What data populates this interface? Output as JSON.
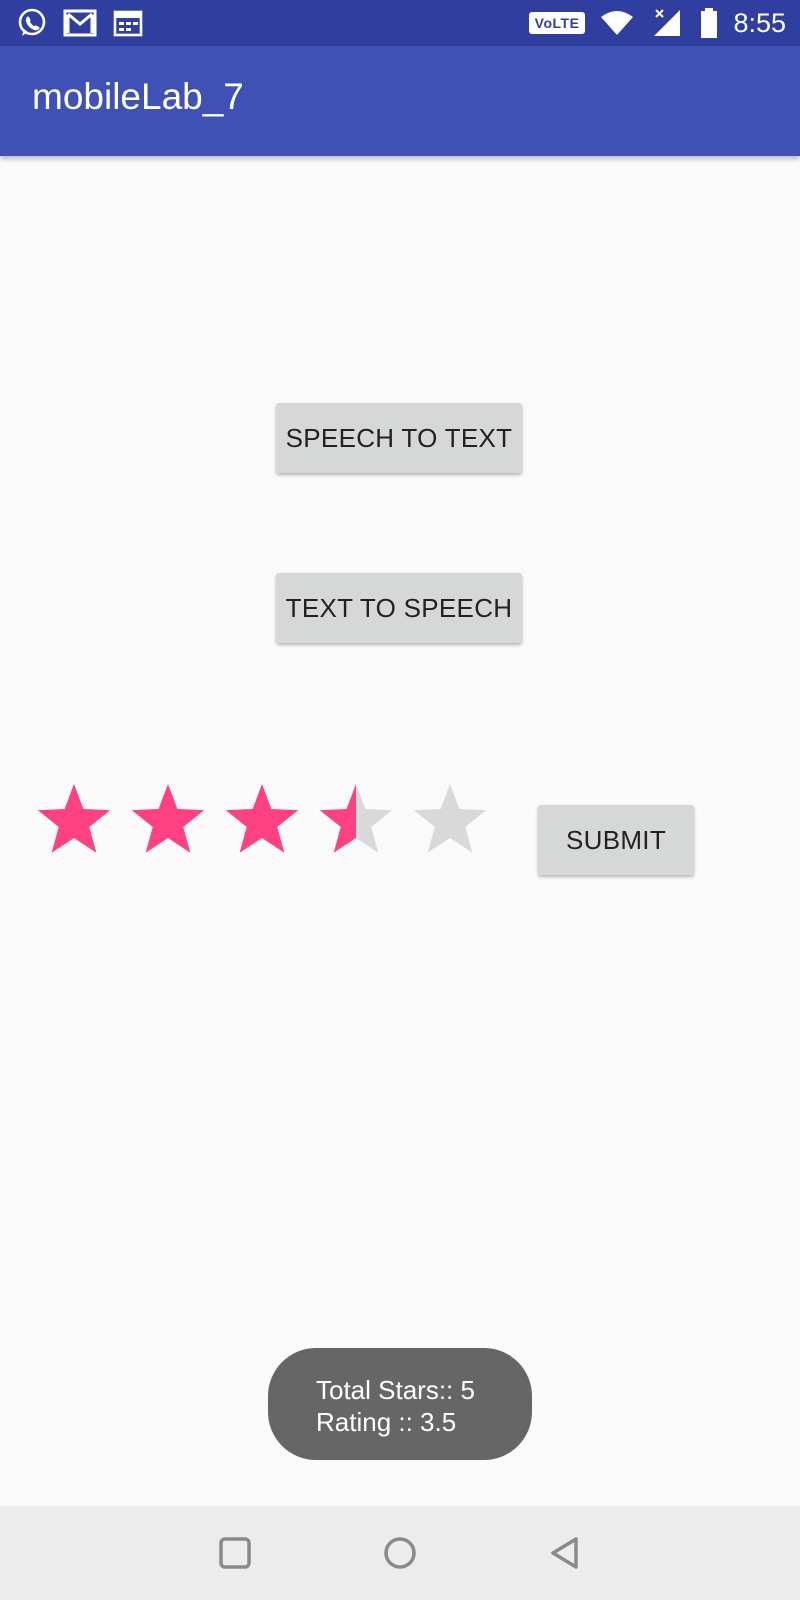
{
  "status_bar": {
    "time": "8:55",
    "network_badge": "VoLTE",
    "icons": [
      "whatsapp-icon",
      "gmail-icon",
      "calendar-icon",
      "wifi-icon",
      "signal-icon",
      "battery-icon"
    ]
  },
  "app_bar": {
    "title": "mobileLab_7"
  },
  "buttons": {
    "speech_to_text": "SPEECH TO TEXT",
    "text_to_speech": "TEXT TO SPEECH",
    "submit": "SUBMIT"
  },
  "rating_bar": {
    "num_stars": 5,
    "rating": 3.5,
    "fill_color": "#ff4081",
    "empty_color": "#d9d9d9"
  },
  "toast": {
    "line1": "Total Stars:: 5",
    "line2": "Rating :: 3.5"
  },
  "nav_bar": {
    "icons": [
      "recents-icon",
      "home-icon",
      "back-icon"
    ]
  },
  "colors": {
    "status_bar": "#303f9f",
    "app_bar": "#3f51b5",
    "accent": "#ff4081"
  }
}
